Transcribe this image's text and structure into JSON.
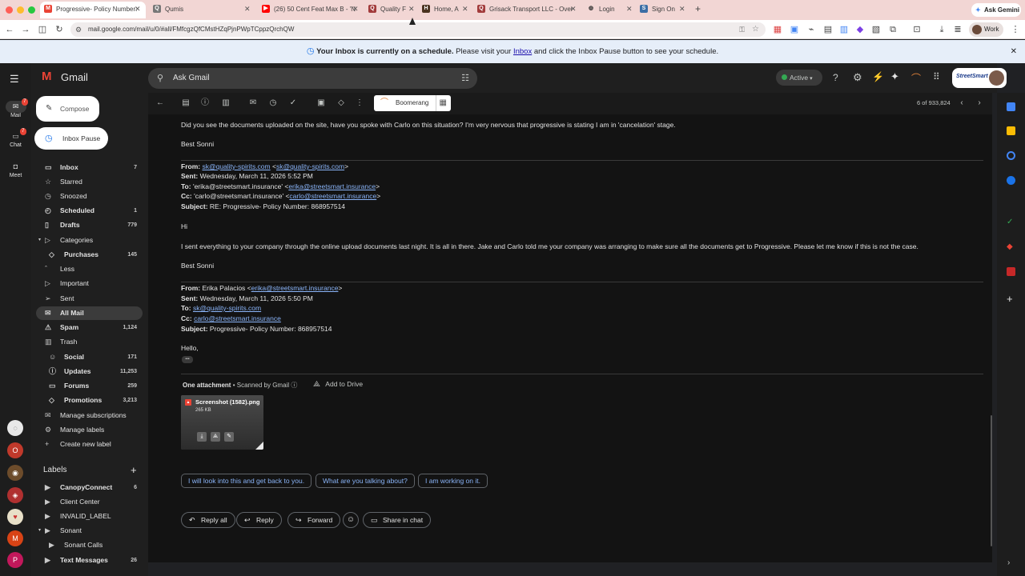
{
  "browser": {
    "tabs": [
      {
        "label": "Progressive- Policy Number:",
        "favicon": "gmail-icon"
      },
      {
        "label": "Qumis",
        "favicon": "qumis-icon"
      },
      {
        "label": "(26) 50 Cent Feat Max B - 'N",
        "favicon": "youtube-icon"
      },
      {
        "label": "Quality F",
        "favicon": "quality-icon"
      },
      {
        "label": "Home, A",
        "favicon": "home-icon"
      },
      {
        "label": "Grisack Transport LLC - Over",
        "favicon": "quality-icon"
      },
      {
        "label": "Login",
        "favicon": "globe-icon"
      },
      {
        "label": "Sign On",
        "favicon": "signon-icon"
      }
    ],
    "url": "mail.google.com/mail/u/0/#all/FMfcgzQfCMstHZqPjnPWpTCppzQrchQW",
    "ask_gemini": "Ask Gemini",
    "profile": "Work"
  },
  "banner": {
    "bold": "Your Inbox is currently on a schedule.",
    "pre": "Please visit your",
    "link": "Inbox",
    "post": "and click the Inbox Pause button to see your schedule."
  },
  "gmail": {
    "logo": "Gmail",
    "search_placeholder": "Ask Gmail",
    "status": "Active",
    "brand": "StreetSmart",
    "compose": "Compose",
    "inbox_pause": "Inbox Pause",
    "boomerang": "Boomerang",
    "pagination": "6 of 933,824"
  },
  "rail": [
    {
      "label": "Mail",
      "badge": "7"
    },
    {
      "label": "Chat",
      "badge": "7"
    },
    {
      "label": "Meet",
      "badge": ""
    }
  ],
  "nav": [
    {
      "label": "Inbox",
      "count": "7",
      "bold": true
    },
    {
      "label": "Starred",
      "count": ""
    },
    {
      "label": "Snoozed",
      "count": ""
    },
    {
      "label": "Scheduled",
      "count": "1",
      "bold": true
    },
    {
      "label": "Drafts",
      "count": "779",
      "bold": true
    },
    {
      "label": "Categories",
      "count": ""
    },
    {
      "label": "Purchases",
      "count": "145",
      "bold": true
    },
    {
      "label": "Less",
      "count": ""
    },
    {
      "label": "Important",
      "count": ""
    },
    {
      "label": "Sent",
      "count": ""
    },
    {
      "label": "All Mail",
      "count": "",
      "bold": true
    },
    {
      "label": "Spam",
      "count": "1,124",
      "bold": true
    },
    {
      "label": "Trash",
      "count": ""
    },
    {
      "label": "Social",
      "count": "171",
      "bold": true
    },
    {
      "label": "Updates",
      "count": "11,253",
      "bold": true
    },
    {
      "label": "Forums",
      "count": "259",
      "bold": true
    },
    {
      "label": "Promotions",
      "count": "3,213",
      "bold": true
    },
    {
      "label": "Manage subscriptions",
      "count": ""
    },
    {
      "label": "Manage labels",
      "count": ""
    },
    {
      "label": "Create new label",
      "count": ""
    }
  ],
  "labels_title": "Labels",
  "labels": [
    {
      "label": "CanopyConnect",
      "count": "6",
      "bold": true
    },
    {
      "label": "Client Center",
      "count": ""
    },
    {
      "label": "INVALID_LABEL",
      "count": ""
    },
    {
      "label": "Sonant",
      "count": ""
    },
    {
      "label": "Sonant Calls",
      "count": ""
    },
    {
      "label": "Text Messages",
      "count": "26",
      "bold": true
    }
  ],
  "email": {
    "line1": "Did you see the documents uploaded on the site, have you spoke with Carlo on this situation? I'm very nervous that progressive is stating I am in 'cancelation' stage.",
    "sign1": "Best Sonni",
    "q1": {
      "from_label": "From:",
      "from_link": "sk@quality-spirits.com",
      "from_mid": " <",
      "from_link2": "sk@quality-spirits.com",
      "from_end": ">",
      "sent_label": "Sent:",
      "sent": " Wednesday, March 11, 2026 5:52 PM",
      "to_label": "To:",
      "to_pre": " 'erika@streetsmart.insurance' <",
      "to_link": "erika@streetsmart.insurance",
      "to_end": ">",
      "cc_label": "Cc:",
      "cc_pre": " 'carlo@streetsmart.insurance' <",
      "cc_link": "carlo@streetsmart.insurance",
      "cc_end": ">",
      "subj_label": "Subject:",
      "subj": " RE: Progressive- Policy Number: 868957514"
    },
    "hi": "Hi",
    "body2": "I sent everything to your company through the online upload documents last night. It is all in there. Jake and Carlo told me your company was arranging to make sure all the documents get to Progressive. Please let me know if this is not the case.",
    "sign2": "Best Sonni",
    "q2": {
      "from_label": "From:",
      "from_pre": " Erika Palacios <",
      "from_link": "erika@streetsmart.insurance",
      "from_end": ">",
      "sent_label": "Sent:",
      "sent": " Wednesday, March 11, 2026 5:50 PM",
      "to_label": "To:",
      "to_link": "sk@quality-spirits.com",
      "cc_label": "Cc:",
      "cc_link": "carlo@streetsmart.insurance",
      "subj_label": "Subject:",
      "subj": " Progressive- Policy Number: 868957514"
    },
    "hello": "Hello,",
    "ellipsis": "•••",
    "attachment_title": "One attachment",
    "scanned": "• Scanned by Gmail",
    "add_to_drive": "Add to Drive",
    "file_name": "Screenshot (1582).png",
    "file_size": "265 KB",
    "smart_replies": [
      "I will look into this and get back to you.",
      "What are you talking about?",
      "I am working on it."
    ],
    "actions": [
      "Reply all",
      "Reply",
      "Forward",
      "Share in chat"
    ]
  },
  "colors": {
    "accent": "#8ab4f8",
    "banner": "#e6eef9",
    "gmail_bg": "#1f1f1f"
  }
}
